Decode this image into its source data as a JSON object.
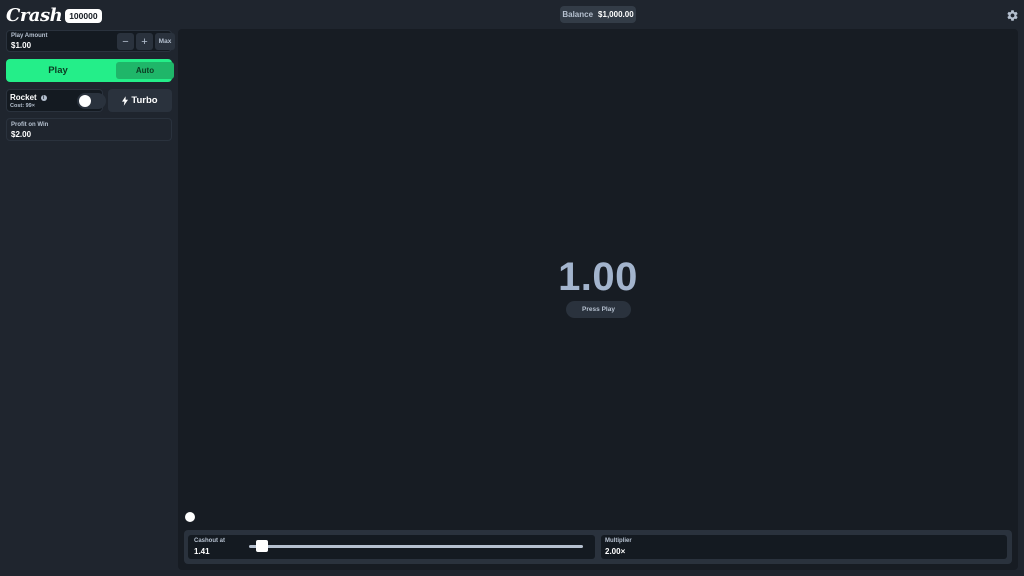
{
  "header": {
    "logo_text": "Crash",
    "logo_badge": "100000",
    "balance_label": "Balance",
    "balance_value": "$1,000.00",
    "settings_icon": "gear-icon"
  },
  "controls": {
    "play_amount_label": "Play Amount",
    "play_amount_value": "$1.00",
    "minus_label": "−",
    "plus_label": "+",
    "max_label": "Max",
    "play_label": "Play",
    "auto_label": "Auto",
    "rocket_label": "Rocket",
    "rocket_info_icon": "info-icon",
    "rocket_cost": "Cost: 99×",
    "rocket_enabled": false,
    "turbo_label": "Turbo",
    "turbo_icon": "bolt-icon",
    "profit_label": "Profit on Win",
    "profit_value": "$2.00"
  },
  "game": {
    "multiplier": "1.00",
    "status_button": "Press Play"
  },
  "bottom": {
    "cashout_label": "Cashout at",
    "cashout_value": "1.41",
    "cashout_slider_fraction": 0.04,
    "multiplier_label": "Multiplier",
    "multiplier_value": "2.00×"
  },
  "colors": {
    "accent_green": "#24ee89",
    "auto_green": "#1fb669",
    "background": "#1f252e",
    "game_background": "#171c23",
    "multiplier_text": "#a3b4cd"
  }
}
